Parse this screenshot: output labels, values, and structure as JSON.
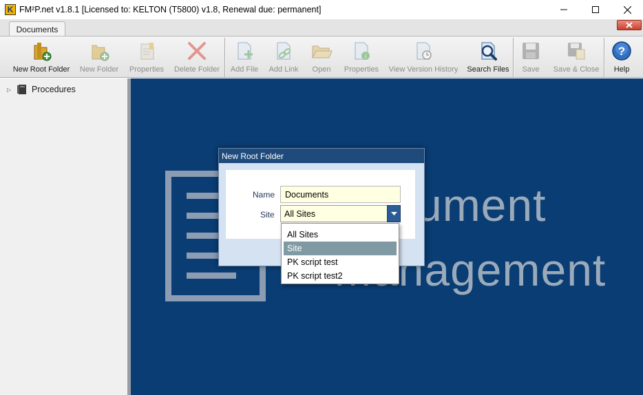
{
  "window": {
    "logo_letter": "K",
    "title": "FM²P.net v1.8.1 [Licensed to: KELTON  (T5800) v1.8, Renewal due: permanent]"
  },
  "ribbon_tab": {
    "label": "Documents"
  },
  "ribbon": {
    "new_root_folder": "New Root Folder",
    "new_folder": "New Folder",
    "folder_properties": "Properties",
    "delete_folder": "Delete Folder",
    "add_file": "Add File",
    "add_link": "Add Link",
    "open": "Open",
    "file_properties": "Properties",
    "view_version_history": "View Version History",
    "search_files": "Search Files",
    "save": "Save",
    "save_close": "Save & Close",
    "help": "Help"
  },
  "tree": {
    "items": [
      {
        "label": "Procedures"
      }
    ]
  },
  "background": {
    "word1": "ument",
    "word2": "Management"
  },
  "dialog": {
    "title": "New Root Folder",
    "name_label": "Name",
    "name_value": "Documents",
    "site_label": "Site",
    "site_value": "All Sites"
  },
  "dropdown": {
    "options": [
      "All Sites",
      "Site",
      "PK script test",
      "PK script test2"
    ],
    "highlighted": "Site"
  },
  "colors": {
    "main_bg": "#0a3d73",
    "dialog_title": "#1e4a7c",
    "input_bg": "#ffffe1",
    "highlight": "#809aa4"
  }
}
